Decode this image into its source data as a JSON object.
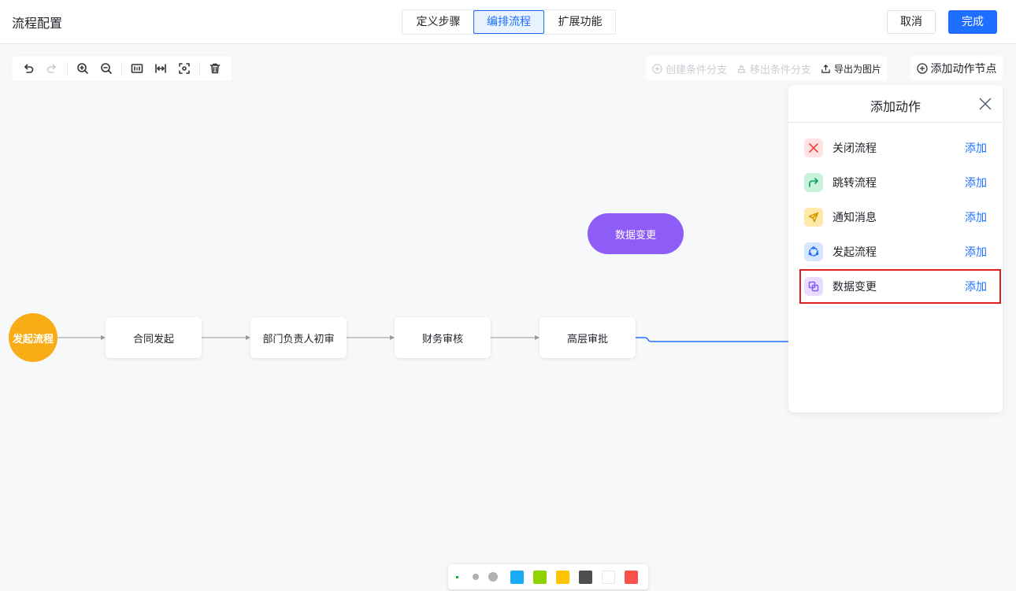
{
  "header": {
    "title": "流程配置",
    "tabs": [
      {
        "label": "定义步骤",
        "active": false
      },
      {
        "label": "编排流程",
        "active": true
      },
      {
        "label": "扩展功能",
        "active": false
      }
    ],
    "cancel_label": "取消",
    "done_label": "完成"
  },
  "toolbar": {
    "items": [
      "undo-icon",
      "redo-icon",
      "zoom-in-icon",
      "zoom-out-icon",
      "actual-size-icon",
      "fit-width-icon",
      "fit-screen-icon",
      "delete-icon"
    ]
  },
  "branch_bar": {
    "create_branch": "创建条件分支",
    "remove_branch": "移出条件分支",
    "export_image": "导出为图片"
  },
  "add_action_node_label": "添加动作节点",
  "flow": {
    "start_label": "发起流程",
    "nodes": [
      "合同发起",
      "部门负责人初审",
      "财务审核",
      "高层审批"
    ],
    "action_node_label": "数据变更"
  },
  "panel": {
    "title": "添加动作",
    "items": [
      {
        "label": "关闭流程",
        "add": "添加",
        "icon": "close-flow-icon",
        "bg": "#fde2e2",
        "color": "#f53f3f"
      },
      {
        "label": "跳转流程",
        "add": "添加",
        "icon": "jump-flow-icon",
        "bg": "#c9f2dd",
        "color": "#00b42a"
      },
      {
        "label": "通知消息",
        "add": "添加",
        "icon": "notify-icon",
        "bg": "#ffe9a8",
        "color": "#d99a00"
      },
      {
        "label": "发起流程",
        "add": "添加",
        "icon": "start-flow-icon",
        "bg": "#d6e6ff",
        "color": "#1e6fff"
      },
      {
        "label": "数据变更",
        "add": "添加",
        "icon": "data-change-icon",
        "bg": "#e8ddff",
        "color": "#8e5cf7",
        "highlighted": true
      }
    ]
  },
  "color_bar": {
    "swatches": [
      "#1aabf5",
      "#8fd400",
      "#ffc300",
      "#4e4e4e",
      "#ffffff",
      "#f9514b"
    ],
    "accent_dot": "#00b42a"
  }
}
